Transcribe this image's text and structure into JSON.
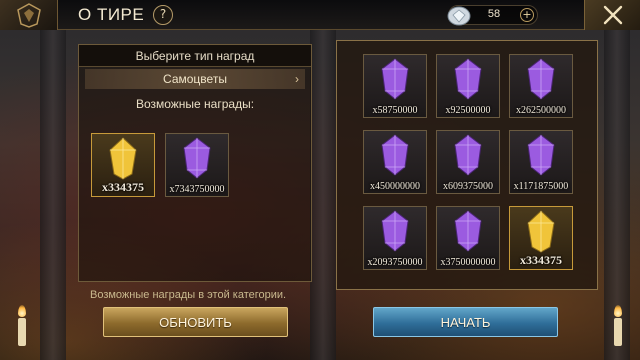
{
  "header": {
    "title": "О ТИРЕ",
    "help_label": "?",
    "currency_amount": "58",
    "add_label": "+"
  },
  "left_panel": {
    "reward_type_label": "Выберите тип наград",
    "category_label": "Самоцветы",
    "category_chevron": "›",
    "possible_rewards_label": "Возможные награды:",
    "rewards": [
      {
        "qty": "x334375",
        "kind": "gold"
      },
      {
        "qty": "x7343750000",
        "kind": "purple"
      }
    ]
  },
  "bottom_hint": "Возможные награды в этой категории.",
  "right_panel": {
    "rewards": [
      {
        "qty": "x58750000",
        "kind": "purple"
      },
      {
        "qty": "x92500000",
        "kind": "purple"
      },
      {
        "qty": "x262500000",
        "kind": "purple"
      },
      {
        "qty": "x450000000",
        "kind": "purple"
      },
      {
        "qty": "x609375000",
        "kind": "purple"
      },
      {
        "qty": "x1171875000",
        "kind": "purple"
      },
      {
        "qty": "x2093750000",
        "kind": "purple"
      },
      {
        "qty": "x3750000000",
        "kind": "purple"
      },
      {
        "qty": "x334375",
        "kind": "gold"
      }
    ]
  },
  "buttons": {
    "refresh_label": "ОБНОВИТЬ",
    "start_label": "НАЧАТЬ"
  },
  "colors": {
    "purple_gem": "#9b5be0",
    "gold_gem": "#f0c43a",
    "refresh_button": "#b8924a",
    "start_button": "#3f86b3"
  }
}
